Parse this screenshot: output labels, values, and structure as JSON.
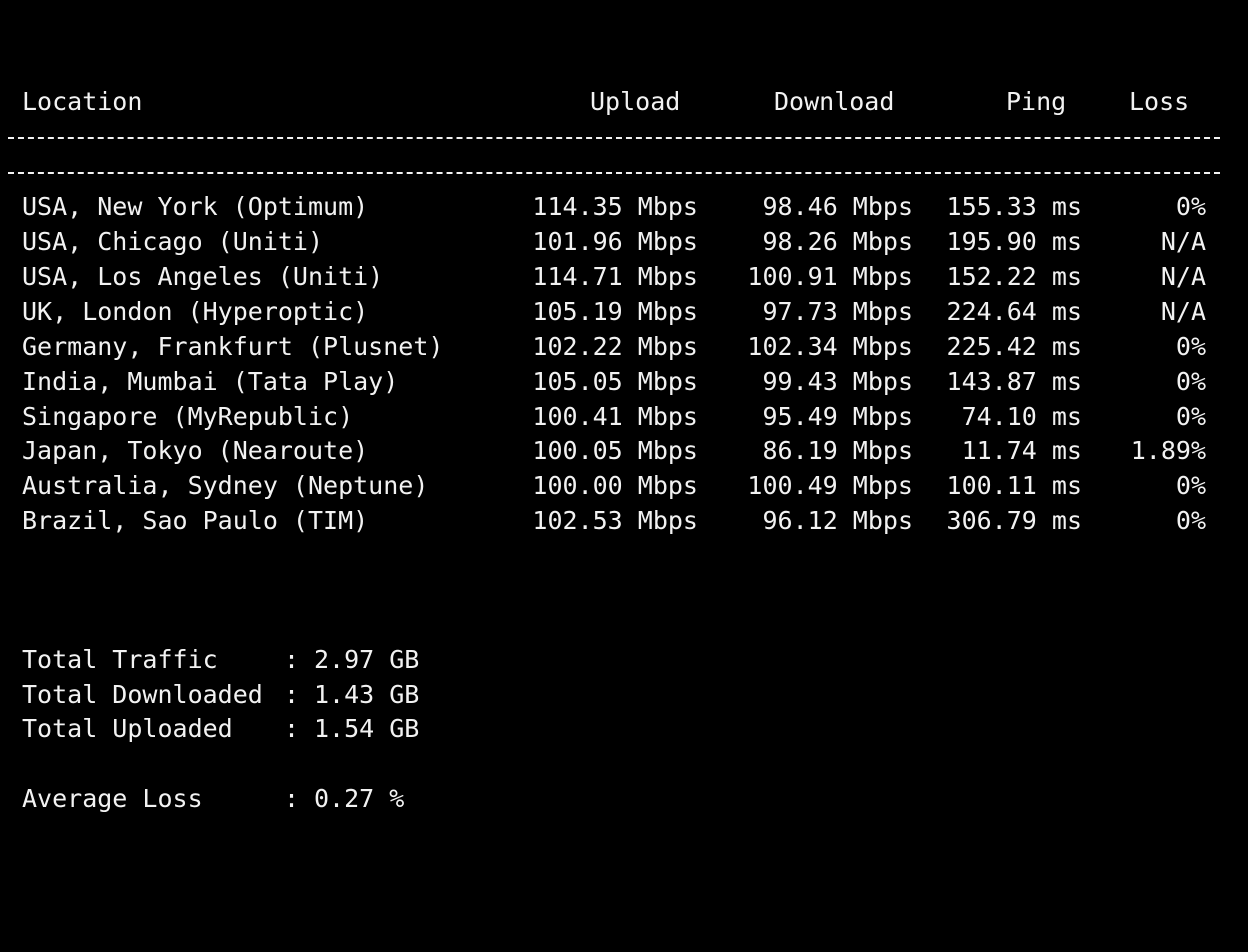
{
  "header": {
    "location": "Location",
    "upload": "Upload",
    "download": "Download",
    "ping": "Ping",
    "loss": "Loss"
  },
  "rows": [
    {
      "location": "USA, New York (Optimum)",
      "upload": "114.35 Mbps",
      "download": "98.46 Mbps",
      "ping": "155.33 ms",
      "loss": "0%"
    },
    {
      "location": "USA, Chicago (Uniti)",
      "upload": "101.96 Mbps",
      "download": "98.26 Mbps",
      "ping": "195.90 ms",
      "loss": "N/A"
    },
    {
      "location": "USA, Los Angeles (Uniti)",
      "upload": "114.71 Mbps",
      "download": "100.91 Mbps",
      "ping": "152.22 ms",
      "loss": "N/A"
    },
    {
      "location": "UK, London (Hyperoptic)",
      "upload": "105.19 Mbps",
      "download": "97.73 Mbps",
      "ping": "224.64 ms",
      "loss": "N/A"
    },
    {
      "location": "Germany, Frankfurt (Plusnet)",
      "upload": "102.22 Mbps",
      "download": "102.34 Mbps",
      "ping": "225.42 ms",
      "loss": "0%"
    },
    {
      "location": "India, Mumbai (Tata Play)",
      "upload": "105.05 Mbps",
      "download": "99.43 Mbps",
      "ping": "143.87 ms",
      "loss": "0%"
    },
    {
      "location": "Singapore (MyRepublic)",
      "upload": "100.41 Mbps",
      "download": "95.49 Mbps",
      "ping": "74.10 ms",
      "loss": "0%"
    },
    {
      "location": "Japan, Tokyo (Nearoute)",
      "upload": "100.05 Mbps",
      "download": "86.19 Mbps",
      "ping": "11.74 ms",
      "loss": "1.89%"
    },
    {
      "location": "Australia, Sydney (Neptune)",
      "upload": "100.00 Mbps",
      "download": "100.49 Mbps",
      "ping": "100.11 ms",
      "loss": "0%"
    },
    {
      "location": "Brazil, Sao Paulo (TIM)",
      "upload": "102.53 Mbps",
      "download": "96.12 Mbps",
      "ping": "306.79 ms",
      "loss": "0%"
    }
  ],
  "summary": {
    "separator": ":",
    "total_traffic_label": "Total Traffic",
    "total_traffic_value": "2.97 GB",
    "total_downloaded_label": "Total Downloaded",
    "total_downloaded_value": "1.43 GB",
    "total_uploaded_label": "Total Uploaded",
    "total_uploaded_value": "1.54 GB",
    "average_loss_label": "Average Loss",
    "average_loss_value": "0.27 %"
  },
  "colors": {
    "background": "#000000",
    "text": "#f2f2f2"
  }
}
